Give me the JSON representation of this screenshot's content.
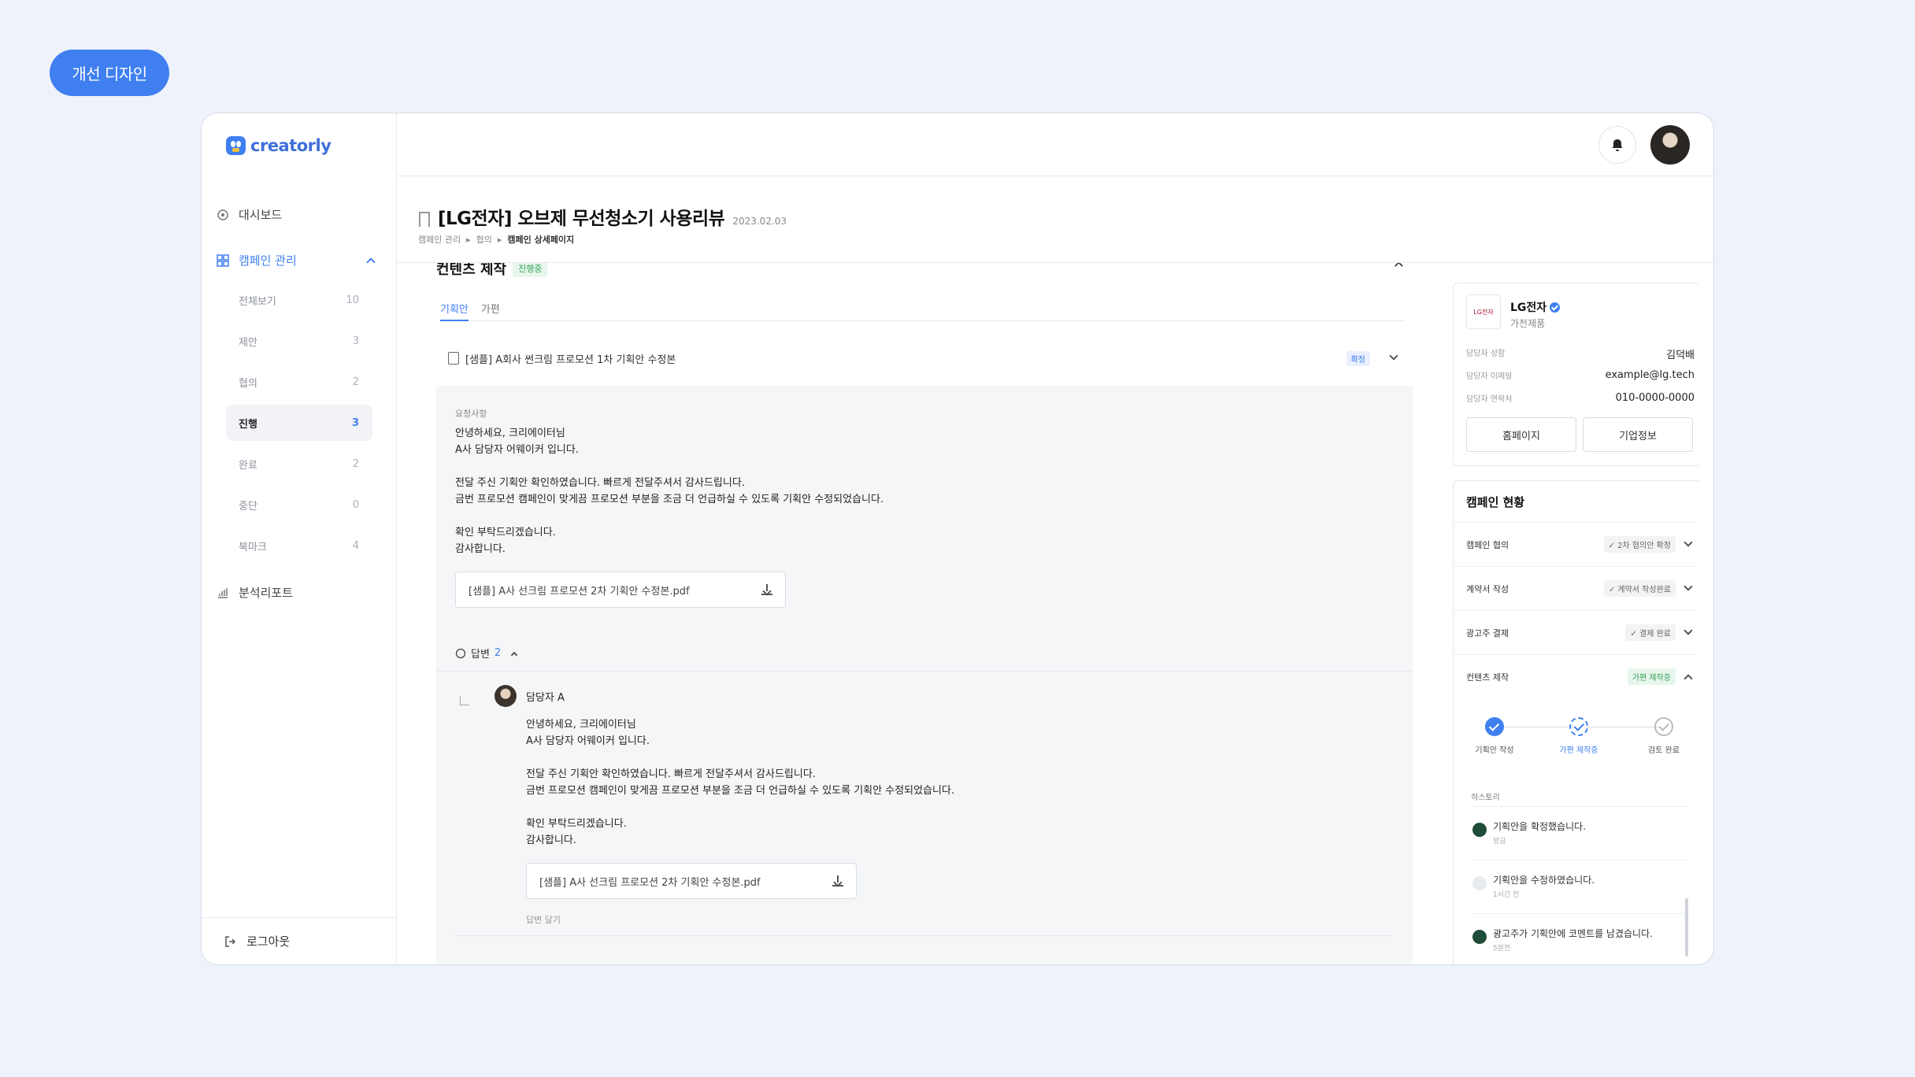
{
  "top_badge": "개선 디자인",
  "brand": "creatorly",
  "sidebar": {
    "dashboard": "대시보드",
    "campaign": "캠페인 관리",
    "sub_items": [
      {
        "label": "전체보기",
        "count": "10"
      },
      {
        "label": "제안",
        "count": "3"
      },
      {
        "label": "협의",
        "count": "2"
      },
      {
        "label": "진행",
        "count": "3"
      },
      {
        "label": "완료",
        "count": "2"
      },
      {
        "label": "중단",
        "count": "0"
      },
      {
        "label": "북마크",
        "count": "4"
      }
    ],
    "report": "분석리포트",
    "logout": "로그아웃"
  },
  "header": {
    "title": "[LG전자] 오브제 무선청소기 사용리뷰",
    "date": "2023.02.03",
    "breadcrumb": [
      "캠페인 관리",
      "협의",
      "캠페인 상세페이지"
    ]
  },
  "content": {
    "section_title": "컨텐츠 제작",
    "section_status": "진행중",
    "tabs": [
      "기획안",
      "가편"
    ],
    "plan_title": "[샘플] A회사 썬크림 프로모션 1차 기획안 수정본",
    "plan_badge": "확정",
    "request_label": "요청사항",
    "request_body": "안녕하세요, 크리에이터님\nA사 담당자 어웨이커 입니다.\n\n전달 주신 기획안 확인하였습니다. 빠르게 전달주셔서 감사드립니다.\n금번 프로모션 캠페인이 맞게끔 프로모션 부분을 조금 더 언급하실 수 있도록 기획안 수정되었습니다.\n\n확인 부탁드리겠습니다.\n감사합니다.",
    "file_name": "[샘플] A사 선크림 프로모션 2차 기획안 수정본.pdf",
    "reply_label": "답변",
    "reply_count": "2",
    "reply": {
      "author": "담당자 A",
      "body": "안녕하세요, 크리에이터님\nA사 담당자 어웨이커 입니다.\n\n전달 주신 기획안 확인하였습니다. 빠르게 전달주셔서 감사드립니다.\n금번 프로모션 캠페인이 맞게끔 프로모션 부분을 조금 더 언급하실 수 있도록 기획안 수정되었습니다.\n\n확인 부탁드리겠습니다.\n감사합니다.",
      "file_name": "[샘플] A사 선크림 프로모션 2차 기획안 수정본.pdf",
      "reply_action": "답변 달기"
    }
  },
  "company": {
    "logo_text": "LG전자",
    "name": "LG전자",
    "category": "가전제품",
    "manager_label": "담당자 성함",
    "manager": "김덕배",
    "email_label": "담당자 이메일",
    "email": "example@lg.tech",
    "phone_label": "담당자 연락처",
    "phone": "010-0000-0000",
    "homepage_btn": "홈페이지",
    "info_btn": "기업정보"
  },
  "campaign_status": {
    "title": "캠페인 현황",
    "rows": [
      {
        "label": "캠페인 협의",
        "status": "2차 협의안 확정"
      },
      {
        "label": "계약서 작성",
        "status": "계약서 작성완료"
      },
      {
        "label": "광고주 결제",
        "status": "결제 완료"
      },
      {
        "label": "컨텐츠 제작",
        "status": "가편 제작중"
      }
    ],
    "steps": [
      "기획안 작성",
      "가편 제작중",
      "검토 완료"
    ],
    "history_label": "히스토리",
    "history": [
      {
        "text": "기획안을 확정했습니다.",
        "time": "방금"
      },
      {
        "text": "기획안을 수정하였습니다.",
        "time": "1시간 전"
      },
      {
        "text": "광고주가 기획안에 코멘트를 남겼습니다.",
        "time": "5분전"
      }
    ]
  }
}
